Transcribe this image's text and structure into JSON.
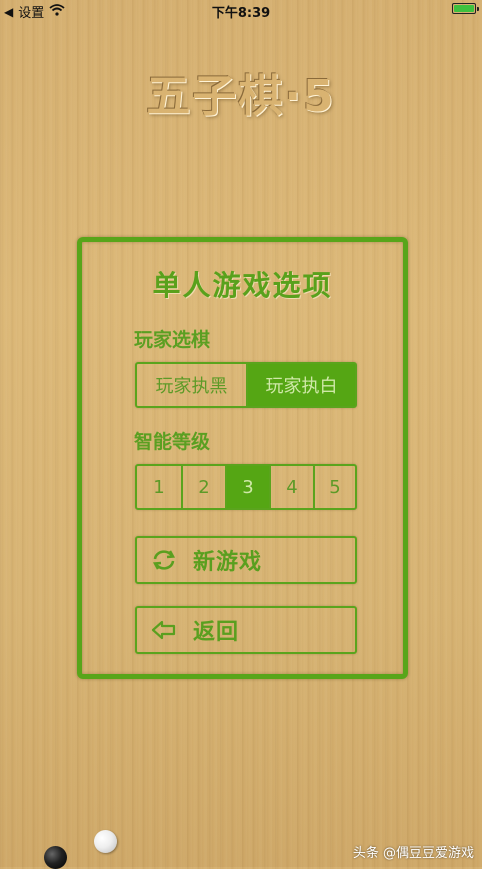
{
  "status_bar": {
    "back_label": "设置",
    "time": "下午8:39"
  },
  "app_title": "五子棋·5",
  "panel": {
    "title": "单人游戏选项",
    "color_section": {
      "label": "玩家选棋",
      "options": [
        "玩家执黑",
        "玩家执白"
      ],
      "selected": "玩家执白"
    },
    "level_section": {
      "label": "智能等级",
      "options": [
        "1",
        "2",
        "3",
        "4",
        "5"
      ],
      "selected": "3"
    },
    "new_game_label": "新游戏",
    "back_label": "返回"
  },
  "watermark": "头条 @偶豆豆爱游戏",
  "colors": {
    "accent_green": "#55a614",
    "wood": "#d8b473"
  }
}
